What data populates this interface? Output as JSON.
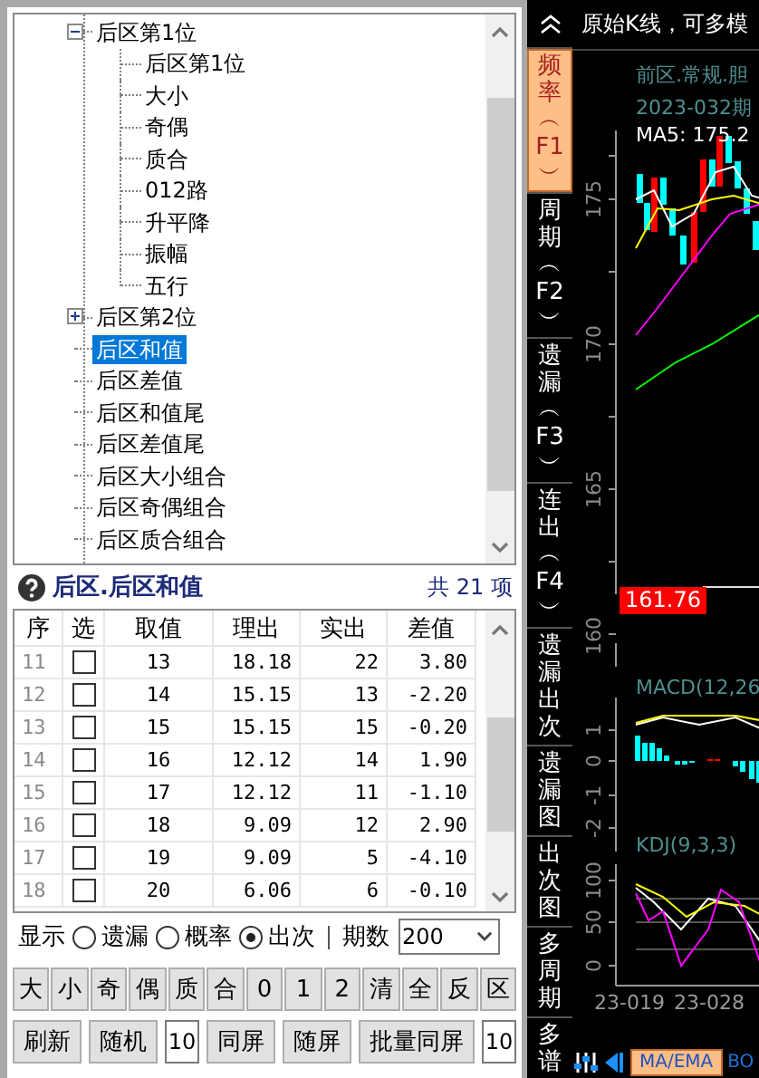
{
  "tree": {
    "items": [
      {
        "label": "后区第1位",
        "selected": false,
        "expanded": true,
        "children": [
          {
            "label": "后区第1位",
            "selected": false
          },
          {
            "label": "大小",
            "selected": false
          },
          {
            "label": "奇偶",
            "selected": false
          },
          {
            "label": "质合",
            "selected": false
          },
          {
            "label": "012路",
            "selected": false
          },
          {
            "label": "升平降",
            "selected": false
          },
          {
            "label": "振幅",
            "selected": false
          },
          {
            "label": "五行",
            "selected": false
          }
        ]
      },
      {
        "label": "后区第2位",
        "selected": false,
        "expanded": false
      },
      {
        "label": "后区和值",
        "selected": true
      },
      {
        "label": "后区差值",
        "selected": false
      },
      {
        "label": "后区和值尾",
        "selected": false
      },
      {
        "label": "后区差值尾",
        "selected": false
      },
      {
        "label": "后区大小组合",
        "selected": false
      },
      {
        "label": "后区奇偶组合",
        "selected": false
      },
      {
        "label": "后区质合组合",
        "selected": false
      }
    ]
  },
  "panel": {
    "title": "后区.后区和值",
    "count": "共 21 项"
  },
  "table": {
    "columns": [
      "序",
      "选",
      "取值",
      "理出",
      "实出",
      "差值"
    ],
    "rows": [
      {
        "index": "11",
        "checked": false,
        "value": "13",
        "expected": "18.18",
        "actual": "22",
        "diff": "3.80"
      },
      {
        "index": "12",
        "checked": false,
        "value": "14",
        "expected": "15.15",
        "actual": "13",
        "diff": "-2.20"
      },
      {
        "index": "13",
        "checked": false,
        "value": "15",
        "expected": "15.15",
        "actual": "15",
        "diff": "-0.20"
      },
      {
        "index": "14",
        "checked": false,
        "value": "16",
        "expected": "12.12",
        "actual": "14",
        "diff": "1.90"
      },
      {
        "index": "15",
        "checked": false,
        "value": "17",
        "expected": "12.12",
        "actual": "11",
        "diff": "-1.10"
      },
      {
        "index": "16",
        "checked": false,
        "value": "18",
        "expected": "9.09",
        "actual": "12",
        "diff": "2.90"
      },
      {
        "index": "17",
        "checked": false,
        "value": "19",
        "expected": "9.09",
        "actual": "5",
        "diff": "-4.10"
      },
      {
        "index": "18",
        "checked": false,
        "value": "20",
        "expected": "6.06",
        "actual": "6",
        "diff": "-0.10"
      }
    ]
  },
  "display": {
    "label": "显示",
    "options": [
      {
        "label": "遗漏",
        "selected": false
      },
      {
        "label": "概率",
        "selected": false
      },
      {
        "label": "出次",
        "selected": true
      }
    ],
    "periods_label": "期数",
    "periods": "200"
  },
  "filter_buttons": [
    "大",
    "小",
    "奇",
    "偶",
    "质",
    "合",
    "0",
    "1",
    "2",
    "清",
    "全",
    "反",
    "区"
  ],
  "actions": [
    {
      "kind": "button",
      "label": "刷新"
    },
    {
      "kind": "button",
      "label": "随机"
    },
    {
      "kind": "field",
      "value": "10"
    },
    {
      "kind": "button",
      "label": "同屏"
    },
    {
      "kind": "button",
      "label": "随屏"
    },
    {
      "kind": "button",
      "label": "批量同屏"
    },
    {
      "kind": "field",
      "value": "10"
    }
  ],
  "chart_panel": {
    "title": "原始K线，可多模",
    "tabs": [
      {
        "label": "频率︵F1︶",
        "selected": true
      },
      {
        "label": "周期︵F2︶",
        "selected": false
      },
      {
        "label": "遗漏︵F3︶",
        "selected": false
      },
      {
        "label": "连出︵F4︶",
        "selected": false
      },
      {
        "label": "遗漏出次",
        "selected": false
      },
      {
        "label": "遗漏图",
        "selected": false
      },
      {
        "label": "出次图",
        "selected": false
      },
      {
        "label": "多周期",
        "selected": false
      },
      {
        "label": "多谱",
        "selected": false
      }
    ],
    "info": [
      "前区.常规.胆",
      "2023-032期"
    ],
    "ma5": "MA5: 175.2",
    "price_ticks": [
      "175",
      "170",
      "165",
      "160"
    ],
    "price_marker": "161.76",
    "macd_title": "MACD(12,26",
    "macd_ticks": [
      "1",
      "0",
      "-1",
      "-2"
    ],
    "kdj_title": "KDJ(9,3,3)",
    "kdj_ticks": [
      "100",
      "50",
      "0"
    ],
    "dates": [
      "23-019",
      "23-028"
    ],
    "toolbar": {
      "button": "MA/EMA",
      "link": "BO"
    }
  }
}
